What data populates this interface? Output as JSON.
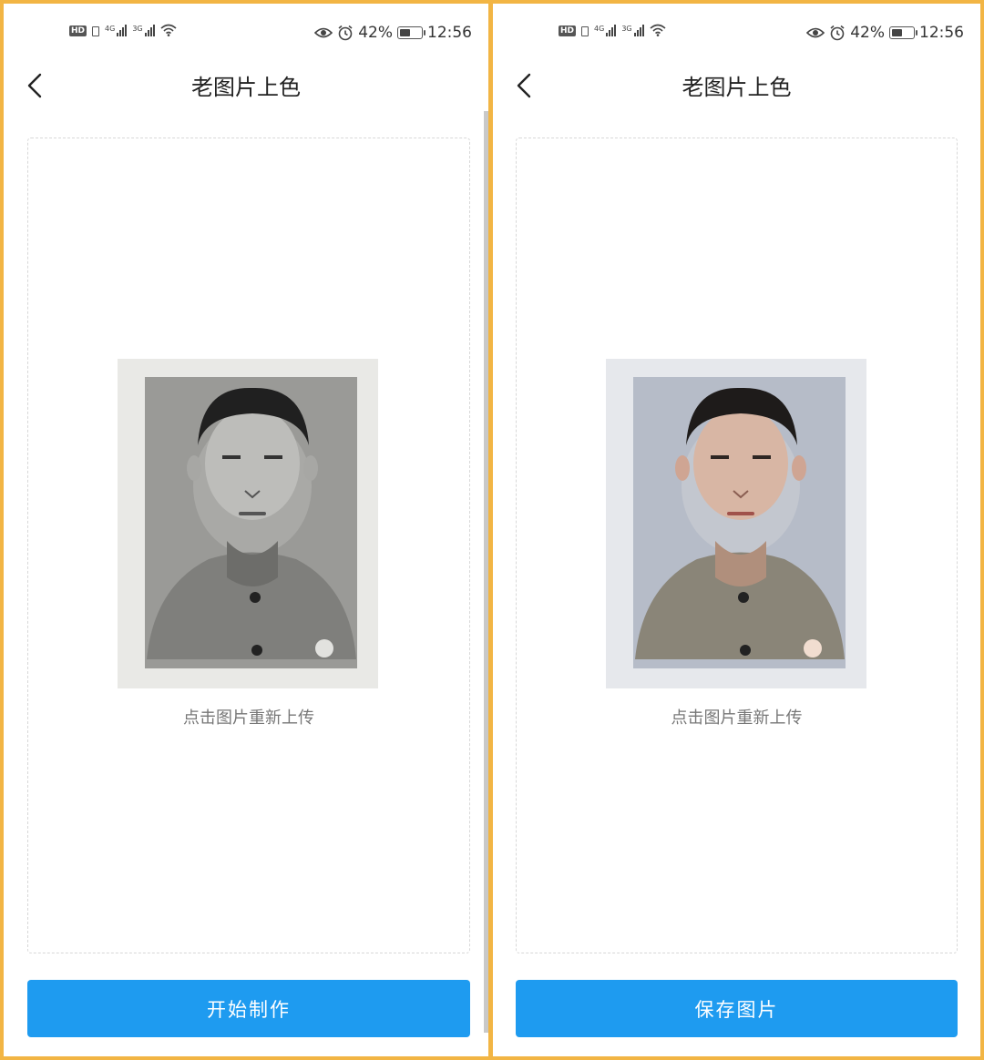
{
  "screens": [
    {
      "status": {
        "time": "12:56",
        "battery": "42%",
        "network1": "4G",
        "network2": "3G",
        "badge": "HD"
      },
      "header": {
        "title": "老图片上色",
        "back_icon": "chevron-left-icon"
      },
      "photo": {
        "variant": "grayscale"
      },
      "hint": "点击图片重新上传",
      "button": {
        "label": "开始制作",
        "color": "#1e9bf0"
      }
    },
    {
      "status": {
        "time": "12:56",
        "battery": "42%",
        "network1": "4G",
        "network2": "3G",
        "badge": "HD"
      },
      "header": {
        "title": "老图片上色",
        "back_icon": "chevron-left-icon"
      },
      "photo": {
        "variant": "colorized"
      },
      "hint": "点击图片重新上传",
      "button": {
        "label": "保存图片",
        "color": "#1e9bf0"
      }
    }
  ],
  "colors": {
    "frame": "#f2b544",
    "accent": "#1e9bf0"
  }
}
